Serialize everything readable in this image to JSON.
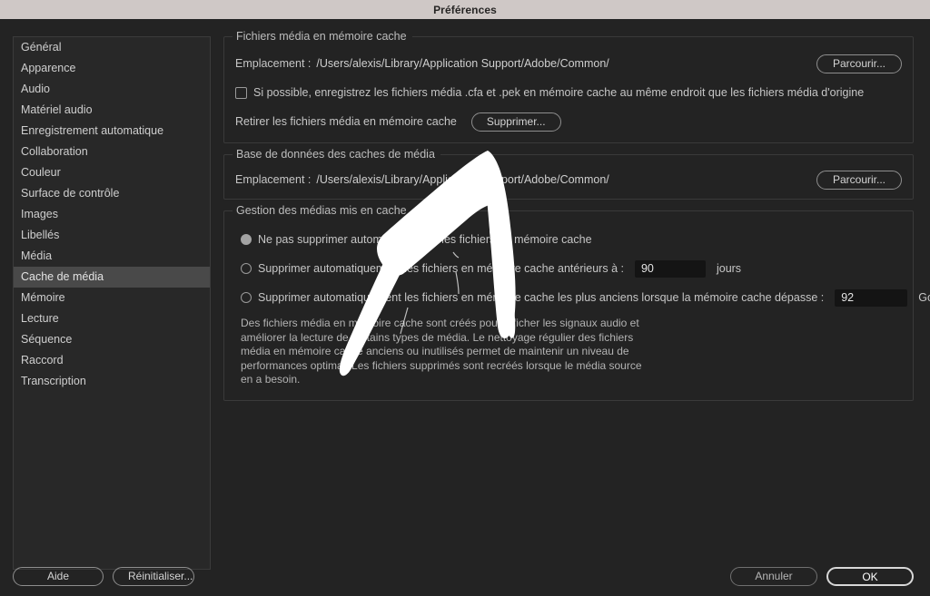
{
  "window": {
    "title": "Préférences"
  },
  "sidebar": {
    "items": [
      {
        "label": "Général",
        "selected": false
      },
      {
        "label": "Apparence",
        "selected": false
      },
      {
        "label": "Audio",
        "selected": false
      },
      {
        "label": "Matériel audio",
        "selected": false
      },
      {
        "label": "Enregistrement automatique",
        "selected": false
      },
      {
        "label": "Collaboration",
        "selected": false
      },
      {
        "label": "Couleur",
        "selected": false
      },
      {
        "label": "Surface de contrôle",
        "selected": false
      },
      {
        "label": "Images",
        "selected": false
      },
      {
        "label": "Libellés",
        "selected": false
      },
      {
        "label": "Média",
        "selected": false
      },
      {
        "label": "Cache de média",
        "selected": true
      },
      {
        "label": "Mémoire",
        "selected": false
      },
      {
        "label": "Lecture",
        "selected": false
      },
      {
        "label": "Séquence",
        "selected": false
      },
      {
        "label": "Raccord",
        "selected": false
      },
      {
        "label": "Transcription",
        "selected": false
      }
    ]
  },
  "media_cache_files": {
    "legend": "Fichiers média en mémoire cache",
    "location_label": "Emplacement :",
    "location_value": "/Users/alexis/Library/Application Support/Adobe/Common/",
    "browse_label": "Parcourir...",
    "same_location_checkbox_label": "Si possible, enregistrez les fichiers média .cfa et .pek en mémoire cache au même endroit que les fichiers média d'origine",
    "same_location_checked": false,
    "remove_label": "Retirer les fichiers média en mémoire cache",
    "delete_label": "Supprimer..."
  },
  "media_cache_database": {
    "legend": "Base de données des caches de média",
    "location_label": "Emplacement :",
    "location_value": "/Users/alexis/Library/Application Support/Adobe/Common/",
    "browse_label": "Parcourir..."
  },
  "cached_media_management": {
    "legend": "Gestion des médias mis en cache",
    "options": [
      {
        "label": "Ne pas supprimer automatiquement les fichiers en mémoire cache",
        "selected": true
      },
      {
        "label": "Supprimer automatiquement les fichiers en mémoire cache antérieurs à :",
        "selected": false,
        "value": "90",
        "unit": "jours"
      },
      {
        "label": "Supprimer automatiquement les fichiers en mémoire cache les plus anciens lorsque la mémoire cache dépasse :",
        "selected": false,
        "value": "92",
        "unit": "Go"
      }
    ],
    "description": "Des fichiers média en mémoire cache sont créés pour afficher les signaux audio et améliorer la lecture de certains types de média. Le nettoyage régulier des fichiers média en mémoire cache anciens ou inutilisés permet de maintenir un niveau de performances optimal. Les fichiers supprimés sont recréés lorsque le média source en a besoin."
  },
  "footer": {
    "help_label": "Aide",
    "reset_label": "Réinitialiser...",
    "cancel_label": "Annuler",
    "ok_label": "OK"
  },
  "annotation": {
    "type": "hand-drawn-arrow",
    "points_to": "Supprimer...",
    "color": "#ffffff"
  },
  "colors": {
    "titlebar_bg": "#cfc8c6",
    "dialog_bg": "#232323",
    "sidebar_bg": "#282828",
    "selected_item_bg": "#494949",
    "field_bg": "#141414"
  }
}
